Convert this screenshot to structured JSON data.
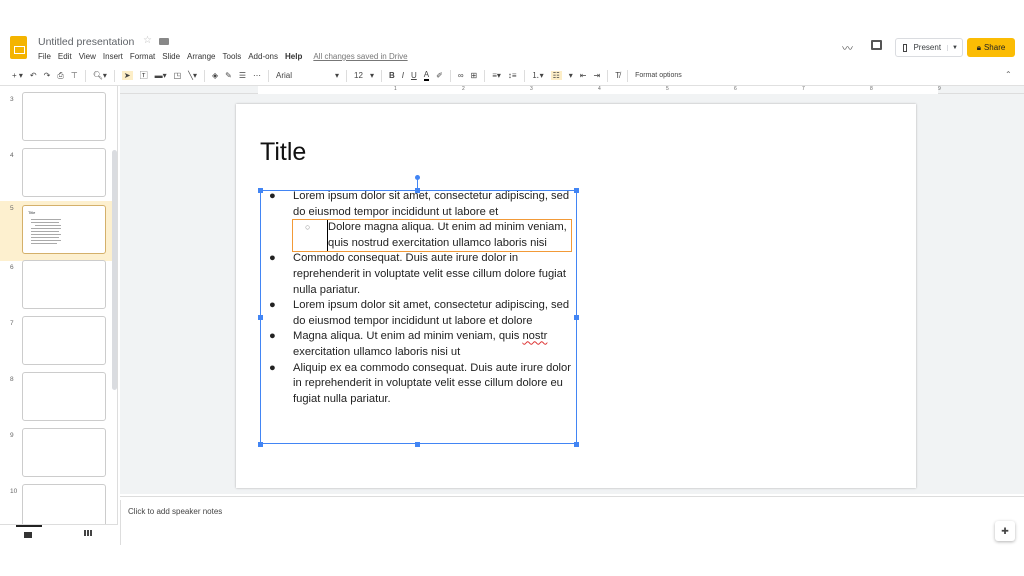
{
  "header": {
    "title": "Untitled presentation",
    "menu": [
      "File",
      "Edit",
      "View",
      "Insert",
      "Format",
      "Slide",
      "Arrange",
      "Tools",
      "Add-ons",
      "Help"
    ],
    "save_status": "All changes saved in Drive",
    "present_label": "Present",
    "share_label": "Share"
  },
  "toolbar": {
    "font": "Arial",
    "font_size": "12",
    "format_options": "Format options"
  },
  "ruler": {
    "numbers": [
      "1",
      "2",
      "3",
      "4",
      "5",
      "6",
      "7",
      "8",
      "9"
    ]
  },
  "filmstrip": {
    "slide_numbers": [
      "3",
      "4",
      "5",
      "6",
      "7",
      "8",
      "9",
      "10"
    ],
    "selected": "5",
    "thumb_title": "Title"
  },
  "slide": {
    "title": "Title",
    "bullets": [
      {
        "level": 1,
        "marker": "●",
        "text": "Lorem ipsum dolor sit amet, consectetur adipiscing, sed do eiusmod tempor incididunt ut labore et"
      },
      {
        "level": 2,
        "marker": "○",
        "text": "Dolore magna aliqua. Ut enim ad minim veniam, quis nostrud exercitation ullamco laboris nisi"
      },
      {
        "level": 1,
        "marker": "●",
        "text": "Commodo consequat. Duis aute irure dolor in reprehenderit in voluptate velit esse cillum dolore fugiat nulla pariatur."
      },
      {
        "level": 1,
        "marker": "●",
        "text": "Lorem ipsum dolor sit amet, consectetur adipiscing, sed do eiusmod tempor incididunt ut labore et dolore"
      },
      {
        "level": 1,
        "marker": "●",
        "text_a": "Magna aliqua. Ut enim ad minim veniam, quis ",
        "misspelled": "nostr",
        "text_b": " exercitation ullamco laboris nisi ut"
      },
      {
        "level": 1,
        "marker": "●",
        "text": "Aliquip ex ea commodo consequat. Duis aute irure dolor in reprehenderit in voluptate velit esse cillum dolore eu fugiat nulla pariatur."
      }
    ]
  },
  "notes": {
    "placeholder": "Click to add speaker notes"
  },
  "colors": {
    "accent": "#fbbc04",
    "selection": "#4285f4",
    "sub_highlight": "#f29a38"
  }
}
